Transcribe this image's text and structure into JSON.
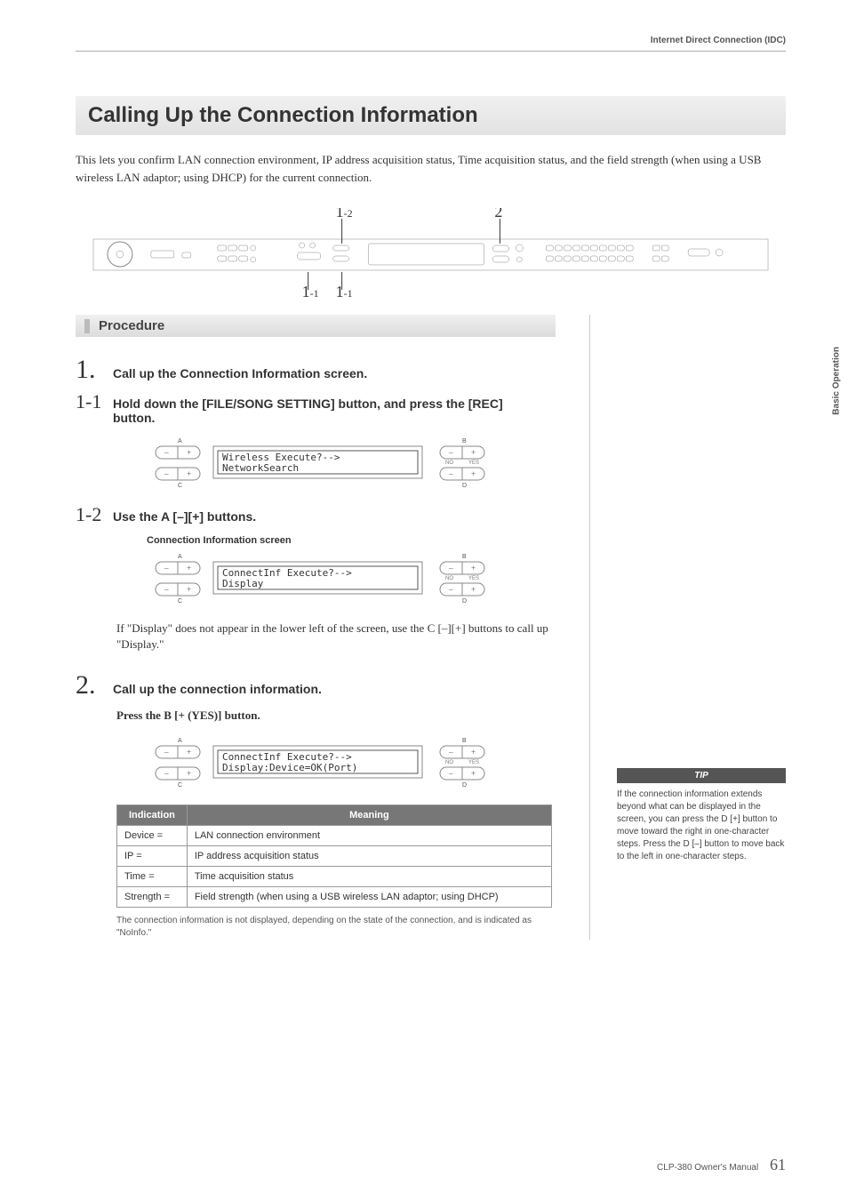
{
  "header": {
    "section": "Internet Direct Connection (IDC)",
    "side_label": "Basic Operation"
  },
  "title": "Calling Up the Connection Information",
  "intro": "This lets you confirm LAN connection environment, IP address acquisition status, Time acquisition status, and the field strength (when using a USB wireless LAN adaptor; using DHCP) for the current connection.",
  "callouts": {
    "c1_2": "1",
    "c1_2_sub": "-2",
    "c2": "2",
    "c1_1a": "1",
    "c1_1a_sub": "-1",
    "c1_1b": "1",
    "c1_1b_sub": "-1"
  },
  "procedure_label": "Procedure",
  "steps": {
    "s1": {
      "num": "1.",
      "title": "Call up the Connection Information screen."
    },
    "s1_1": {
      "num": "1-1",
      "title": "Hold down the [FILE/SONG SETTING] button, and press the [REC] button."
    },
    "s1_2": {
      "num": "1-2",
      "title": "Use the A [–][+] buttons."
    },
    "s2": {
      "num": "2.",
      "title": "Call up the connection information.",
      "sub": "Press the B [+ (YES)] button."
    }
  },
  "screen_label": "Connection Information screen",
  "displays": {
    "d1": {
      "line1": "Wireless      Execute?-->",
      "line2": "NetworkSearch"
    },
    "d2": {
      "line1": "ConnectInf    Execute?-->",
      "line2": "Display"
    },
    "d3": {
      "line1": "ConnectInf   Execute?-->",
      "line2": "Display:Device=OK(Port)"
    }
  },
  "btn_labels": {
    "A": "A",
    "B": "B",
    "C": "C",
    "D": "D",
    "NO": "NO",
    "YES": "YES",
    "minus": "–",
    "plus": "+"
  },
  "note": "If \"Display\" does not appear in the lower left of the screen, use the C [–][+] buttons to call up \"Display.\"",
  "tip": {
    "header": "TIP",
    "body": "If the connection information extends beyond what can be displayed in the screen, you can press the D [+] button to move toward the right in one-character steps. Press the D [–] button to move back to the left in one-character steps."
  },
  "table": {
    "h1": "Indication",
    "h2": "Meaning",
    "rows": [
      {
        "ind": "Device =",
        "mean": "LAN connection environment"
      },
      {
        "ind": "IP =",
        "mean": "IP address acquisition status"
      },
      {
        "ind": "Time =",
        "mean": "Time acquisition status"
      },
      {
        "ind": "Strength =",
        "mean": "Field strength (when using a USB wireless LAN adaptor; using DHCP)"
      }
    ]
  },
  "foot_note": "The connection information is not displayed, depending on the state of the connection, and is indicated as \"NoInfo.\"",
  "footer": {
    "manual": "CLP-380 Owner's Manual",
    "page": "61"
  }
}
